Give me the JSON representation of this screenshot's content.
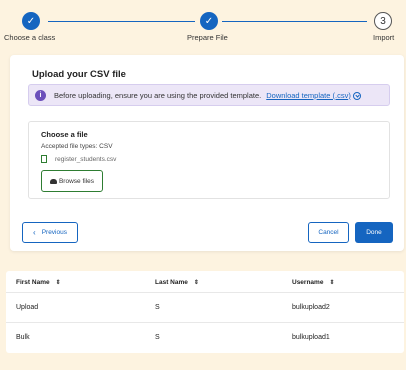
{
  "stepper": {
    "steps": [
      {
        "label": "Choose a class",
        "state": "done",
        "marker": "✓"
      },
      {
        "label": "Prepare File",
        "state": "done",
        "marker": "✓"
      },
      {
        "label": "Import",
        "state": "todo",
        "marker": "3"
      }
    ]
  },
  "upload": {
    "title": "Upload your CSV file",
    "notice_text": "Before uploading, ensure you are using the provided template.",
    "download_link": "Download template (.csv)",
    "file_title": "Choose a file",
    "accepted": "Accepted file types: CSV",
    "filename": "register_students.csv",
    "browse_label": "Browse files"
  },
  "actions": {
    "previous": "Previous",
    "cancel": "Cancel",
    "done": "Done"
  },
  "table": {
    "headers": [
      "First Name",
      "Last Name",
      "Username"
    ],
    "rows": [
      [
        "Upload",
        "S",
        "bulkupload2"
      ],
      [
        "Bulk",
        "S",
        "bulkupload1"
      ]
    ]
  },
  "colors": {
    "accent": "#1565c0",
    "notice_bg": "#ece6f7",
    "page_bg": "#fdf3e0",
    "success": "#2e7d32"
  }
}
